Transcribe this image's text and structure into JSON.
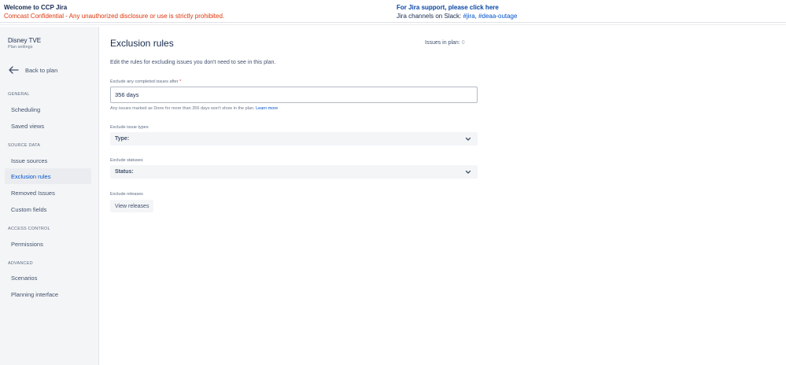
{
  "banner": {
    "title": "Welcome to CCP Jira",
    "warning": "Comcast Confidential - Any unauthorized disclosure or use is strictly prohibited.",
    "support_link": "For Jira support, please click here",
    "slack_prefix": "Jira channels on Slack: ",
    "slack_channel_1": "#jira",
    "slack_separator": ", ",
    "slack_channel_2": "#deaa-outage"
  },
  "sidebar": {
    "project_name": "Disney TVE",
    "project_sub": "Plan settings",
    "back_label": "Back to plan",
    "sections": {
      "general": "GENERAL",
      "source_data": "SOURCE DATA",
      "access_control": "ACCESS CONTROL",
      "advanced": "ADVANCED"
    },
    "items": {
      "scheduling": "Scheduling",
      "saved_views": "Saved views",
      "issue_sources": "Issue sources",
      "exclusion_rules": "Exclusion rules",
      "removed_issues": "Removed Issues",
      "custom_fields": "Custom fields",
      "permissions": "Permissions",
      "scenarios": "Scenarios",
      "planning_interface": "Planning interface"
    }
  },
  "main": {
    "title": "Exclusion rules",
    "issues_in_plan_label": "Issues in plan: ",
    "issues_in_plan_count": "0",
    "intro": "Edit the rules for excluding issues you don't need to see in this plan.",
    "completed_label": "Exclude any completed issues after",
    "completed_required": "*",
    "completed_value": "356 days",
    "completed_helper": "Any issues marked as Done for more than 356 days won't show in the plan.",
    "learn_more": "Learn more",
    "issue_types_label": "Exclude issue types",
    "issue_types_select": "Type:",
    "statuses_label": "Exclude statuses",
    "statuses_select": "Status:",
    "releases_label": "Exclude releases",
    "view_releases_button": "View releases"
  },
  "icons": {
    "back": "arrow-left-icon",
    "chevron": "chevron-down-icon"
  }
}
